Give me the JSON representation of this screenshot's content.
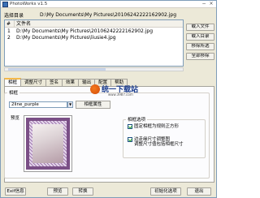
{
  "window": {
    "title": "PhotoWorks v1.5",
    "buttons": [
      "−",
      "×"
    ]
  },
  "dir": {
    "label": "选择目录",
    "value": "D:\\My Documents\\My Pictures\\20106242222162902.jpg"
  },
  "filelist": {
    "headers": [
      "#",
      "文件名"
    ],
    "rows": [
      {
        "num": "1",
        "file": "D:\\My Documents\\My Pictures\\20106242222162902.jpg"
      },
      {
        "num": "2",
        "file": "D:\\My Documents\\My Pictures\\liusie4.jpg"
      }
    ]
  },
  "side_buttons": [
    "载入文件",
    "载入目录",
    "移除所选",
    "全部移除"
  ],
  "tabs": [
    "相框",
    "调整尺寸",
    "签名",
    "效果",
    "输出",
    "配置",
    "帮助"
  ],
  "active_tab": "相框",
  "frame": {
    "group_label": "相框",
    "selected": "2line_purple",
    "props_button": "相框属性",
    "preview_label": "预览"
  },
  "options": {
    "group_label": "相框选项",
    "items": [
      {
        "label": "固定相框为规则正方形",
        "checked": true
      },
      {
        "label": "边走缘尺寸调整图",
        "label2": "调整尺寸值包括相框尺寸",
        "checked": true
      }
    ]
  },
  "bottom_buttons": [
    "Exif信息",
    "预览",
    "转换",
    "初始化选项",
    "退出"
  ],
  "watermark": {
    "brand": "统一下载站",
    "url": "www.3987.com"
  },
  "colors": {
    "accent": "#f5b94a",
    "frame_purple": "#7a4f86"
  }
}
